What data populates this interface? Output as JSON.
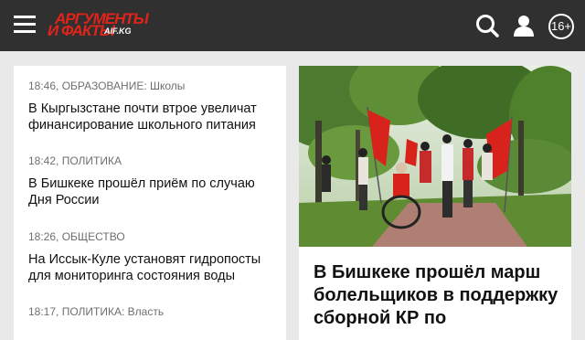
{
  "header": {
    "logo_line1": "АРГУМЕНТЫ",
    "logo_line2": "И ФАКТЫ",
    "logo_domain": "AIF.KG",
    "age_rating": "16+",
    "icons": [
      "menu-icon",
      "search-icon",
      "user-icon"
    ]
  },
  "news": [
    {
      "time": "18:46",
      "rubric": "ОБРАЗОВАНИЕ: Школы",
      "title": "В Кыргызстане почти втрое увеличат финансирование школьного питания"
    },
    {
      "time": "18:42",
      "rubric": "ПОЛИТИКА",
      "title": "В Бишкеке прошёл приём по случаю Дня России"
    },
    {
      "time": "18:26",
      "rubric": "ОБЩЕСТВО",
      "title": "На Иссык-Куле установят гидропосты для мониторинга состояния воды"
    },
    {
      "time": "18:17",
      "rubric": "ПОЛИТИКА: Власть",
      "title": ""
    }
  ],
  "featured": {
    "title": "В Бишкеке прошёл марш болельщиков в поддержку сборной КР по"
  },
  "colors": {
    "header_bg": "#303030",
    "brand_red": "#e2231a",
    "page_bg": "#e9e9e9"
  }
}
